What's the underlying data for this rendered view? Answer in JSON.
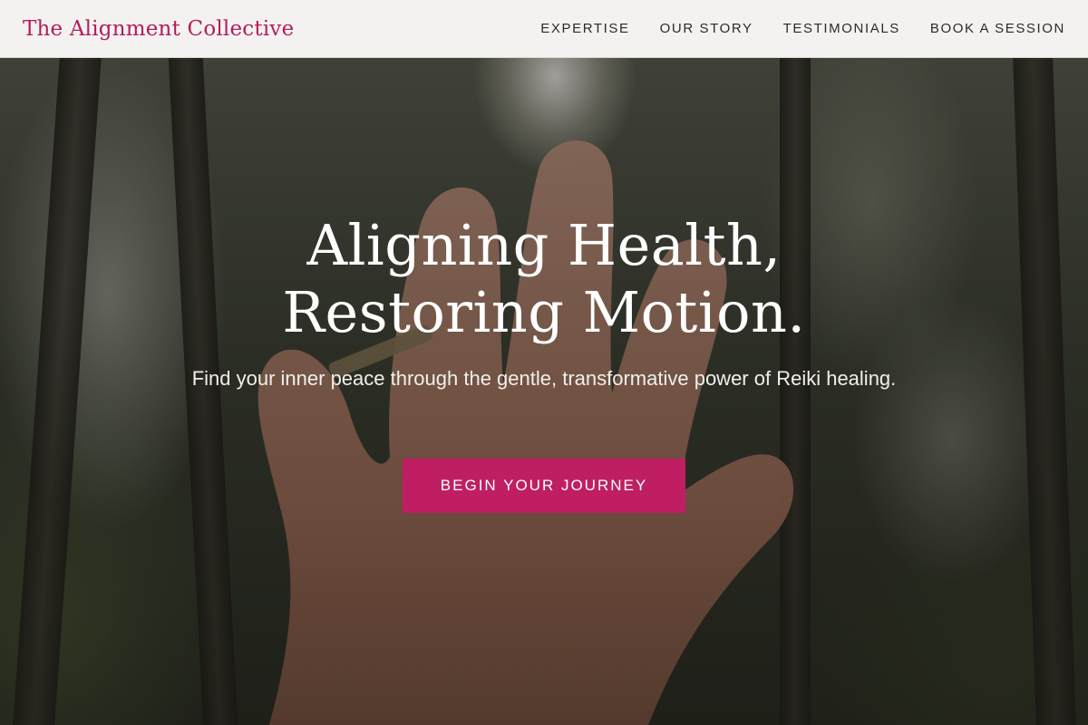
{
  "header": {
    "brand": "The Alignment Collective",
    "nav": [
      {
        "label": "EXPERTISE"
      },
      {
        "label": "OUR STORY"
      },
      {
        "label": "TESTIMONIALS"
      },
      {
        "label": "BOOK A SESSION"
      }
    ]
  },
  "hero": {
    "headline_line1": "Aligning Health,",
    "headline_line2": "Restoring Motion.",
    "subtext": "Find your inner peace through the gentle, transformative power of Reiki healing.",
    "cta_label": "BEGIN YOUR JOURNEY"
  },
  "colors": {
    "brand": "#b41d5d",
    "cta": "#bf1f62",
    "header_bg": "#f3f2f0"
  }
}
